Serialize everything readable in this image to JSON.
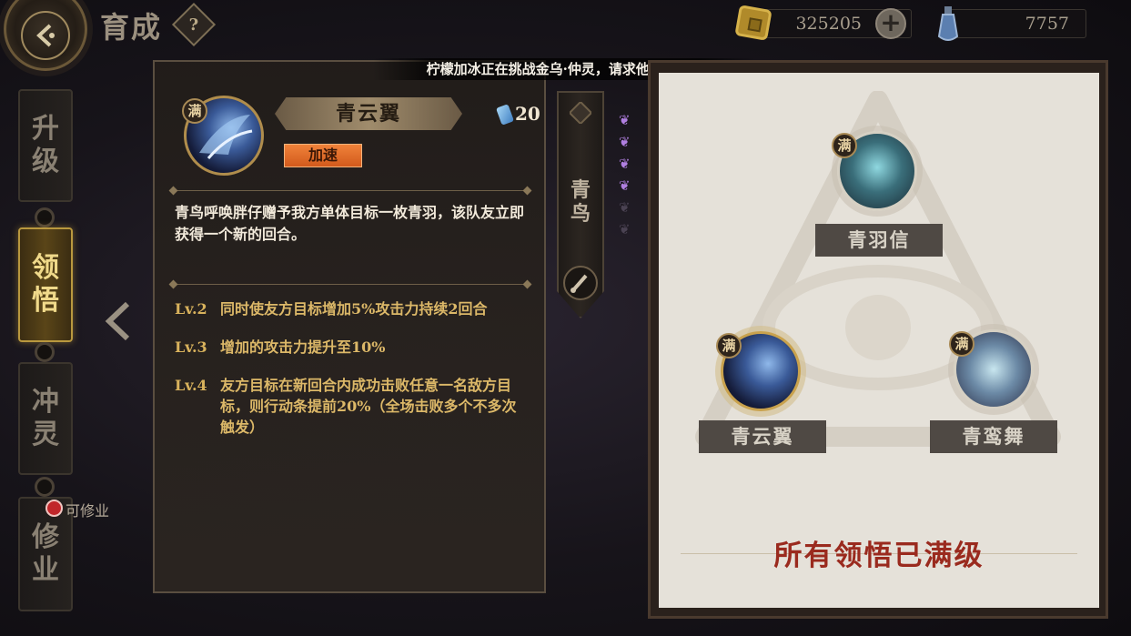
{
  "header": {
    "title": "育成",
    "help_glyph": "?",
    "gold_amount": "325205",
    "potion_amount": "7757"
  },
  "tabs": [
    {
      "label_1": "升",
      "label_2": "级",
      "active": false
    },
    {
      "label_1": "领",
      "label_2": "悟",
      "active": true
    },
    {
      "label_1": "冲",
      "label_2": "灵",
      "active": false
    },
    {
      "label_1": "修",
      "label_2": "业",
      "active": false
    }
  ],
  "cultivate_hint": "可修业",
  "notice": "柠檬加冰正在挑战金乌·仲灵，请求他人协助~",
  "skill": {
    "badge": "满",
    "name": "青云翼",
    "cost": "20",
    "tag": "加速",
    "description": "青鸟呼唤胖仔赠予我方单体目标一枚青羽，该队友立即获得一个新的回合。",
    "levels": [
      {
        "lv": "Lv.2",
        "text": "同时使友方目标增加5%攻击力持续2回合"
      },
      {
        "lv": "Lv.3",
        "text": "增加的攻击力提升至10%"
      },
      {
        "lv": "Lv.4",
        "text": "友方目标在新回合内成功击败任意一名敌方目标，则行动条提前20%（全场击败多个不多次触发）"
      }
    ]
  },
  "character_bar": {
    "label_1": "青",
    "label_2": "鸟"
  },
  "tree": {
    "nodes": [
      {
        "badge": "满",
        "name": "青羽信"
      },
      {
        "badge": "满",
        "name": "青云翼"
      },
      {
        "badge": "满",
        "name": "青鸾舞"
      }
    ],
    "status": "所有领悟已满级"
  },
  "colors": {
    "accent_gold": "#d8b25c",
    "status_red": "#9a2a1e",
    "speed_tag": "#e56c28"
  }
}
